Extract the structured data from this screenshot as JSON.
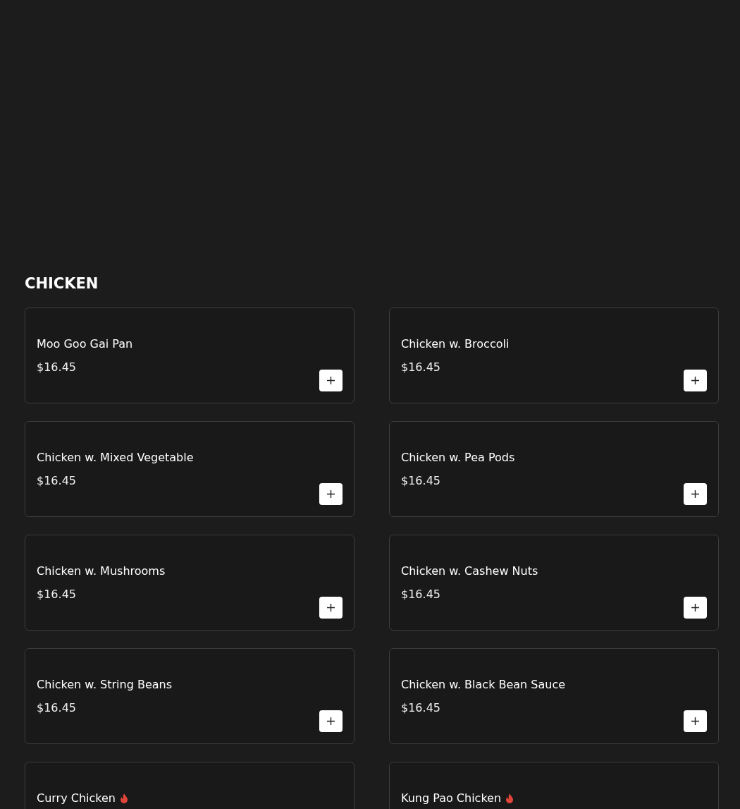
{
  "section": {
    "title": "CHICKEN"
  },
  "items": [
    {
      "name": "Moo Goo Gai Pan",
      "price": "$16.45",
      "spicy": false
    },
    {
      "name": "Chicken w. Broccoli",
      "price": "$16.45",
      "spicy": false
    },
    {
      "name": "Chicken w. Mixed Vegetable",
      "price": "$16.45",
      "spicy": false
    },
    {
      "name": "Chicken w. Pea Pods",
      "price": "$16.45",
      "spicy": false
    },
    {
      "name": "Chicken w. Mushrooms",
      "price": "$16.45",
      "spicy": false
    },
    {
      "name": "Chicken w. Cashew Nuts",
      "price": "$16.45",
      "spicy": false
    },
    {
      "name": "Chicken w. String Beans",
      "price": "$16.45",
      "spicy": false
    },
    {
      "name": "Chicken w. Black Bean Sauce",
      "price": "$16.45",
      "spicy": false
    },
    {
      "name": "Curry Chicken",
      "spicy": true
    },
    {
      "name": "Kung Pao Chicken",
      "spicy": true
    }
  ]
}
